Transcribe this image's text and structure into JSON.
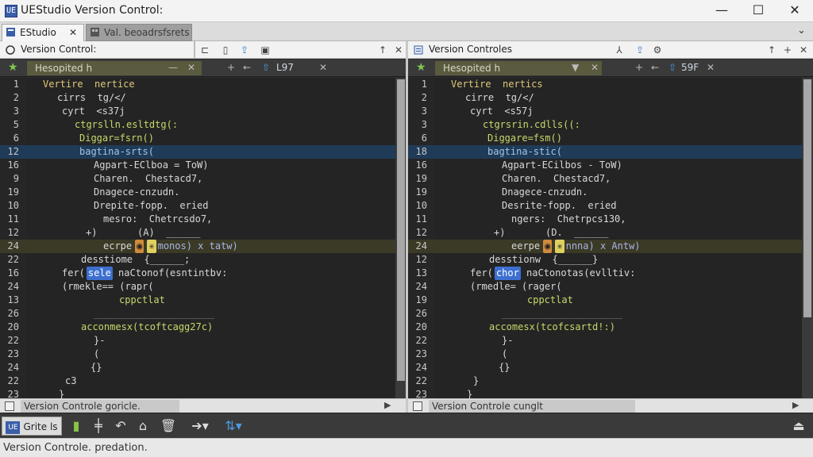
{
  "window": {
    "title": "UEStudio Version Control:",
    "app_icon": "UE",
    "minimize": "—",
    "maximize": "☐",
    "close": "✕"
  },
  "tabs": [
    {
      "label": "EStudio",
      "close": "✕"
    },
    {
      "label": "Val. beoadrsfsrets"
    }
  ],
  "tabbar_chevron": "⌄",
  "panes": {
    "left": {
      "title": "Version Control:",
      "file": "Hesopited  h",
      "meta": "L97",
      "lines": [
        {
          "n": "1",
          "t": "Vertire  nertice",
          "ind": 20,
          "c": "#e0c97a"
        },
        {
          "n": "2",
          "t": "cirrs  tg/</",
          "ind": 38,
          "c": "#d8d8d8"
        },
        {
          "n": "3",
          "t": "cyrt  <s37j",
          "ind": 44,
          "c": "#d8d8d8"
        },
        {
          "n": "5",
          "t": "ctgrslln.esltdtg(:",
          "ind": 60,
          "c": "#c8d86a"
        },
        {
          "n": "6",
          "t": "Diggar=fsrn()",
          "ind": 66,
          "c": "#c8d86a"
        },
        {
          "n": "12",
          "t": "bagtina-srts(",
          "ind": 66,
          "c": "#9ec8e8",
          "hl": "blue"
        },
        {
          "n": "16",
          "t": "Agpart-EClboa = ToW)",
          "ind": 84,
          "c": "#d8d8d8"
        },
        {
          "n": "9",
          "t": "Charen.  Chestacd7,",
          "ind": 84,
          "c": "#d8d8d8"
        },
        {
          "n": "19",
          "t": "Dnagece-cnzudn.",
          "ind": 84,
          "c": "#d8d8d8"
        },
        {
          "n": "10",
          "t": "Drepite-fopp.  eried",
          "ind": 84,
          "c": "#d8d8d8"
        },
        {
          "n": "11",
          "t": "mesro:  Chetrcsdo7,",
          "ind": 96,
          "c": "#d8d8d8"
        },
        {
          "n": "12",
          "t": "+)       (A)  ______",
          "ind": 74,
          "c": "#d8d8d8"
        },
        {
          "n": "24",
          "t": "ecrpe",
          "ind": 96,
          "c": "#d8d8d8",
          "hl": "olive",
          "extra": "monos) x tatw)"
        },
        {
          "n": "22",
          "t": "desstiome  {______;",
          "ind": 68,
          "c": "#d8d8d8"
        },
        {
          "n": "16",
          "t": "fer(",
          "ind": 44,
          "c": "#d8d8d8",
          "chip": "sele",
          "after": " naCtonof(esntintbv:"
        },
        {
          "n": "24",
          "t": "(rmekle== (rapr(",
          "ind": 44,
          "c": "#d8d8d8"
        },
        {
          "n": "13",
          "t": "cppctlat",
          "ind": 116,
          "c": "#c8d86a"
        },
        {
          "n": "26",
          "t": "_____________________",
          "ind": 84,
          "c": "#888"
        },
        {
          "n": "20",
          "t": "acconmesx(tcoftcagg27c)",
          "ind": 68,
          "c": "#c8d86a"
        },
        {
          "n": "22",
          "t": "}-",
          "ind": 84,
          "c": "#d8d8d8"
        },
        {
          "n": "23",
          "t": "(",
          "ind": 84,
          "c": "#d8d8d8"
        },
        {
          "n": "24",
          "t": "{}",
          "ind": 80,
          "c": "#d8d8d8"
        },
        {
          "n": "22",
          "t": "c3",
          "ind": 48,
          "c": "#d8d8d8"
        },
        {
          "n": "23",
          "t": "}",
          "ind": 40,
          "c": "#d8d8d8"
        }
      ],
      "footer": "Version Controle goricle."
    },
    "right": {
      "title": "Version Controles",
      "file": "Hesopited  h",
      "meta": "59F",
      "lines": [
        {
          "n": "1",
          "t": "Vertire  nertics",
          "ind": 20,
          "c": "#e0c97a"
        },
        {
          "n": "2",
          "t": "cirre  tg/</",
          "ind": 38,
          "c": "#d8d8d8"
        },
        {
          "n": "3",
          "t": "cyrt  <s57j",
          "ind": 44,
          "c": "#d8d8d8"
        },
        {
          "n": "3",
          "t": "ctgrsrin.cdlls((:",
          "ind": 60,
          "c": "#c8d86a"
        },
        {
          "n": "6",
          "t": "Diggare=fsm()",
          "ind": 66,
          "c": "#c8d86a"
        },
        {
          "n": "18",
          "t": "bagtina-stic(",
          "ind": 66,
          "c": "#9ec8e8",
          "hl": "blue"
        },
        {
          "n": "16",
          "t": "Agpart-ECilbos - ToW)",
          "ind": 84,
          "c": "#d8d8d8"
        },
        {
          "n": "19",
          "t": "Charen.  Chestacd7,",
          "ind": 84,
          "c": "#d8d8d8"
        },
        {
          "n": "19",
          "t": "Dnagece-cnzudn.",
          "ind": 84,
          "c": "#d8d8d8"
        },
        {
          "n": "10",
          "t": "Desrite-fopp.  eried",
          "ind": 84,
          "c": "#d8d8d8"
        },
        {
          "n": "11",
          "t": "ngers:  Chetrpcs130,",
          "ind": 96,
          "c": "#d8d8d8"
        },
        {
          "n": "12",
          "t": "+)       (D.  ______",
          "ind": 74,
          "c": "#d8d8d8"
        },
        {
          "n": "24",
          "t": "eerpe",
          "ind": 96,
          "c": "#d8d8d8",
          "hl": "olive",
          "extra": "nnna) x Antw)"
        },
        {
          "n": "12",
          "t": "desstionw  {______}",
          "ind": 68,
          "c": "#d8d8d8"
        },
        {
          "n": "13",
          "t": "fer(",
          "ind": 44,
          "c": "#d8d8d8",
          "chip": "chor",
          "after": " naCtonotas(evlltiv:"
        },
        {
          "n": "24",
          "t": "(rmedle= (rager(",
          "ind": 44,
          "c": "#d8d8d8"
        },
        {
          "n": "19",
          "t": "cppctlat",
          "ind": 116,
          "c": "#c8d86a"
        },
        {
          "n": "26",
          "t": "_____________________",
          "ind": 84,
          "c": "#888"
        },
        {
          "n": "20",
          "t": "accomesx(tcofcsartd!:)",
          "ind": 68,
          "c": "#c8d86a"
        },
        {
          "n": "22",
          "t": "}-",
          "ind": 84,
          "c": "#d8d8d8"
        },
        {
          "n": "23",
          "t": "(",
          "ind": 84,
          "c": "#d8d8d8"
        },
        {
          "n": "24",
          "t": "{}",
          "ind": 80,
          "c": "#d8d8d8"
        },
        {
          "n": "22",
          "t": "}",
          "ind": 48,
          "c": "#d8d8d8"
        },
        {
          "n": "23",
          "t": "}",
          "ind": 40,
          "c": "#d8d8d8"
        }
      ],
      "footer": "Version Controle cunglt"
    }
  },
  "bottombar": {
    "label": "Grite ls"
  },
  "status": {
    "text": "Version Controle. predation."
  },
  "colors": {
    "accent": "#3a5ea8",
    "highlight_blue": "#1f3b58",
    "highlight_olive": "#3b3a26"
  }
}
